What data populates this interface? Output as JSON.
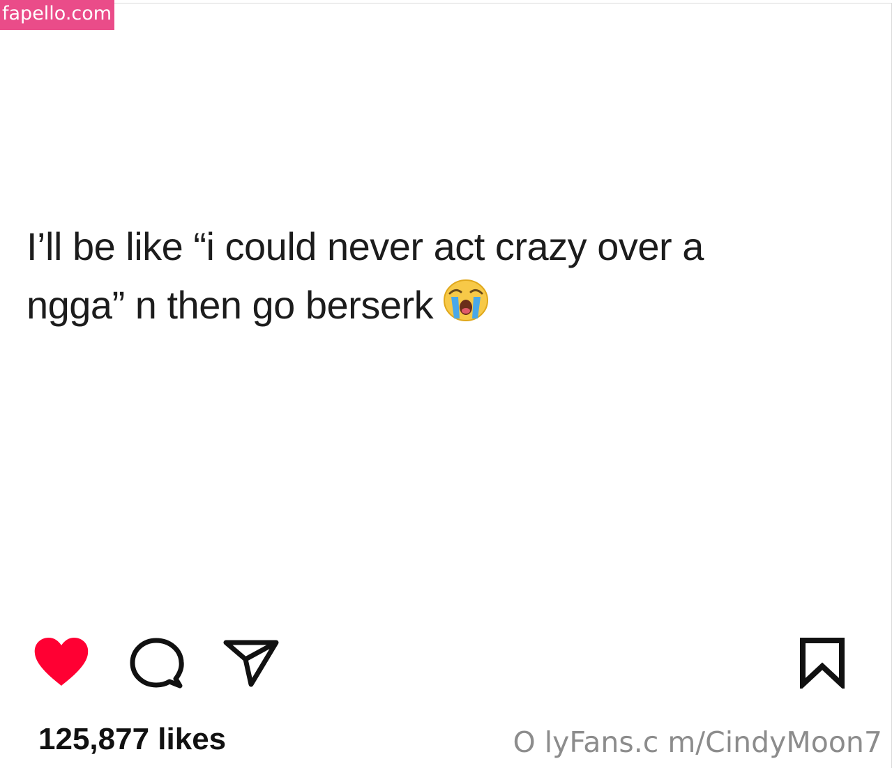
{
  "watermark_top": "fapello.com",
  "post": {
    "text_line_1": "I’ll be like “i could never act crazy over a",
    "text_line_2": "ngga” n then go berserk",
    "emoji": "loudly-crying-face"
  },
  "actions": {
    "like_icon": "heart-filled-icon",
    "comment_icon": "comment-bubble-icon",
    "share_icon": "paper-plane-icon",
    "save_icon": "bookmark-icon",
    "like_color": "#ff0033"
  },
  "likes_text": "125,877 likes",
  "watermark_bottom": "O lyFans.c m/CindyMoon7"
}
